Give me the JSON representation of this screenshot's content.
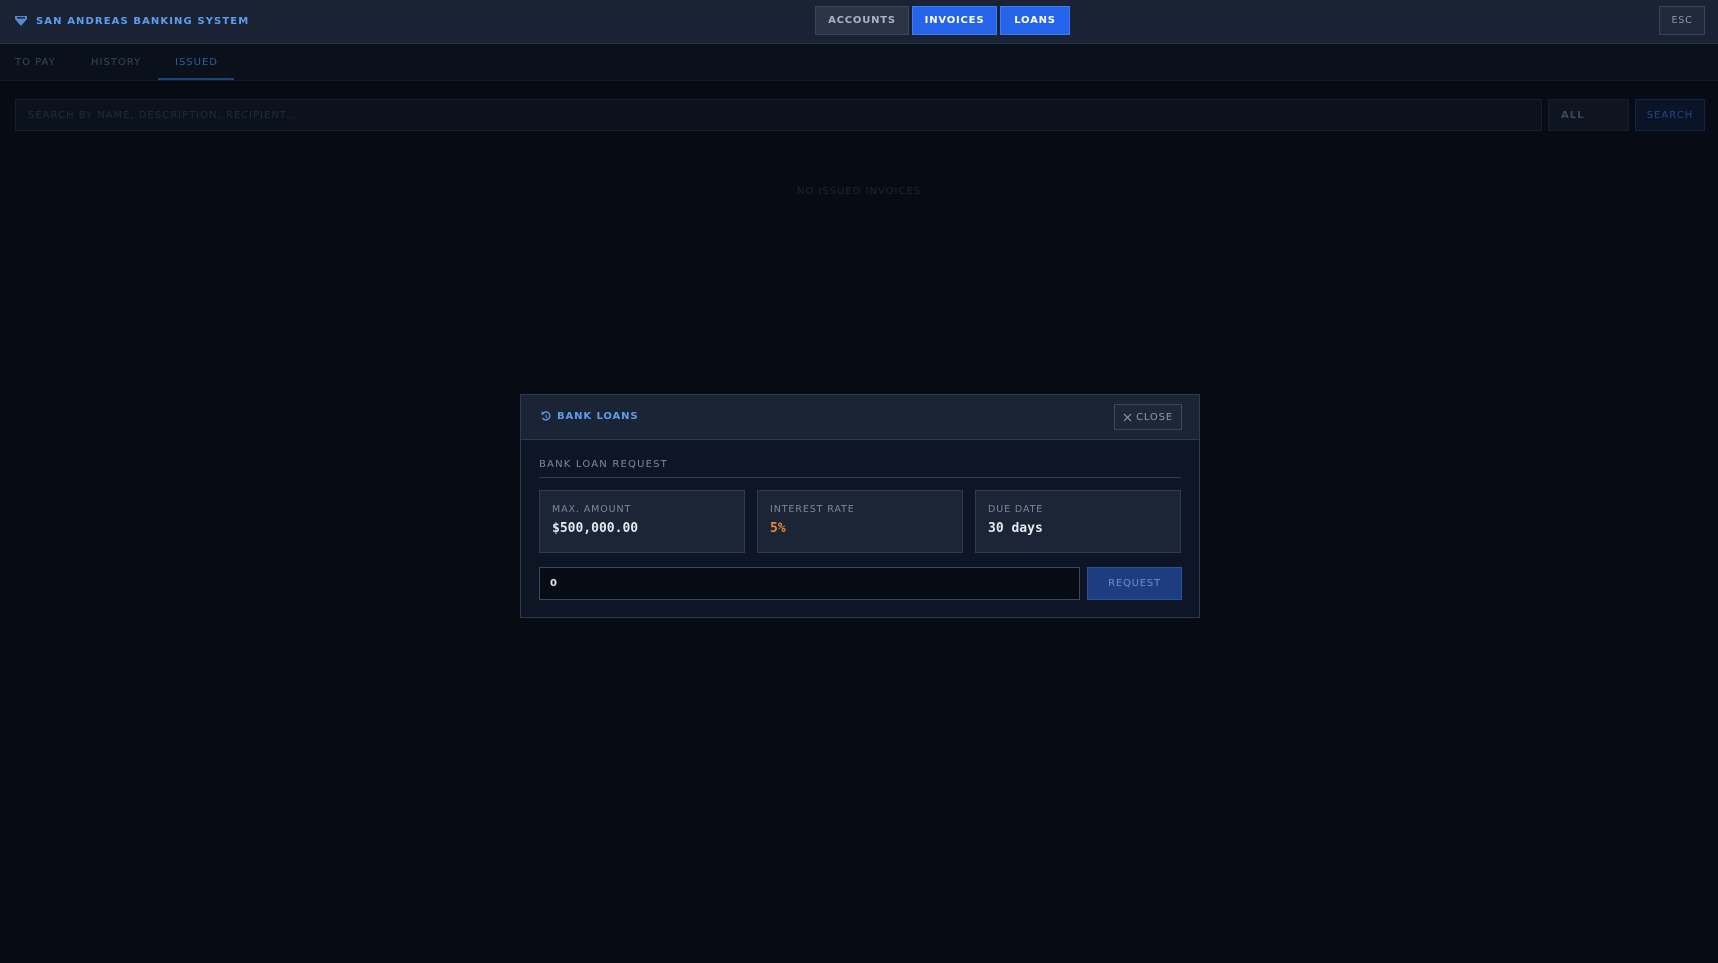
{
  "header": {
    "brand_title": "SAN ANDREAS BANKING SYSTEM",
    "brand_icon": "shield-icon",
    "nav_tabs": [
      {
        "label": "ACCOUNTS",
        "active": false
      },
      {
        "label": "INVOICES",
        "active": true
      },
      {
        "label": "LOANS",
        "active": true
      }
    ],
    "esc_label": "ESC"
  },
  "subtabs": [
    {
      "label": "TO PAY",
      "active": false
    },
    {
      "label": "HISTORY",
      "active": false
    },
    {
      "label": "ISSUED",
      "active": true
    }
  ],
  "search": {
    "placeholder": "SEARCH BY NAME, DESCRIPTION, RECIPIENT...",
    "filter_value": "ALL",
    "button_label": "SEARCH"
  },
  "empty_message": "NO ISSUED INVOICES",
  "modal": {
    "title": "BANK LOANS",
    "title_icon": "loan-refresh-icon",
    "close_label": "CLOSE",
    "section_title": "BANK LOAN REQUEST",
    "stats": [
      {
        "label": "MAX. AMOUNT",
        "value": "$500,000.00"
      },
      {
        "label": "INTEREST RATE",
        "value": "5%"
      },
      {
        "label": "DUE DATE",
        "value": "30 days"
      }
    ],
    "amount_value": "0",
    "request_label": "REQUEST"
  },
  "colors": {
    "accent": "#2563eb",
    "brand_text": "#5f9cf0",
    "interest_rate": "#e8893a"
  }
}
